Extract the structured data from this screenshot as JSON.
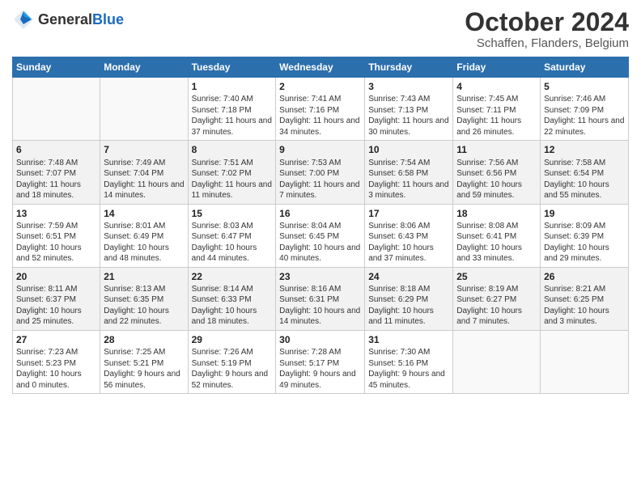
{
  "logo": {
    "general": "General",
    "blue": "Blue"
  },
  "title": "October 2024",
  "location": "Schaffen, Flanders, Belgium",
  "days_of_week": [
    "Sunday",
    "Monday",
    "Tuesday",
    "Wednesday",
    "Thursday",
    "Friday",
    "Saturday"
  ],
  "weeks": [
    [
      {
        "day": "",
        "sunrise": "",
        "sunset": "",
        "daylight": ""
      },
      {
        "day": "",
        "sunrise": "",
        "sunset": "",
        "daylight": ""
      },
      {
        "day": "1",
        "sunrise": "Sunrise: 7:40 AM",
        "sunset": "Sunset: 7:18 PM",
        "daylight": "Daylight: 11 hours and 37 minutes."
      },
      {
        "day": "2",
        "sunrise": "Sunrise: 7:41 AM",
        "sunset": "Sunset: 7:16 PM",
        "daylight": "Daylight: 11 hours and 34 minutes."
      },
      {
        "day": "3",
        "sunrise": "Sunrise: 7:43 AM",
        "sunset": "Sunset: 7:13 PM",
        "daylight": "Daylight: 11 hours and 30 minutes."
      },
      {
        "day": "4",
        "sunrise": "Sunrise: 7:45 AM",
        "sunset": "Sunset: 7:11 PM",
        "daylight": "Daylight: 11 hours and 26 minutes."
      },
      {
        "day": "5",
        "sunrise": "Sunrise: 7:46 AM",
        "sunset": "Sunset: 7:09 PM",
        "daylight": "Daylight: 11 hours and 22 minutes."
      }
    ],
    [
      {
        "day": "6",
        "sunrise": "Sunrise: 7:48 AM",
        "sunset": "Sunset: 7:07 PM",
        "daylight": "Daylight: 11 hours and 18 minutes."
      },
      {
        "day": "7",
        "sunrise": "Sunrise: 7:49 AM",
        "sunset": "Sunset: 7:04 PM",
        "daylight": "Daylight: 11 hours and 14 minutes."
      },
      {
        "day": "8",
        "sunrise": "Sunrise: 7:51 AM",
        "sunset": "Sunset: 7:02 PM",
        "daylight": "Daylight: 11 hours and 11 minutes."
      },
      {
        "day": "9",
        "sunrise": "Sunrise: 7:53 AM",
        "sunset": "Sunset: 7:00 PM",
        "daylight": "Daylight: 11 hours and 7 minutes."
      },
      {
        "day": "10",
        "sunrise": "Sunrise: 7:54 AM",
        "sunset": "Sunset: 6:58 PM",
        "daylight": "Daylight: 11 hours and 3 minutes."
      },
      {
        "day": "11",
        "sunrise": "Sunrise: 7:56 AM",
        "sunset": "Sunset: 6:56 PM",
        "daylight": "Daylight: 10 hours and 59 minutes."
      },
      {
        "day": "12",
        "sunrise": "Sunrise: 7:58 AM",
        "sunset": "Sunset: 6:54 PM",
        "daylight": "Daylight: 10 hours and 55 minutes."
      }
    ],
    [
      {
        "day": "13",
        "sunrise": "Sunrise: 7:59 AM",
        "sunset": "Sunset: 6:51 PM",
        "daylight": "Daylight: 10 hours and 52 minutes."
      },
      {
        "day": "14",
        "sunrise": "Sunrise: 8:01 AM",
        "sunset": "Sunset: 6:49 PM",
        "daylight": "Daylight: 10 hours and 48 minutes."
      },
      {
        "day": "15",
        "sunrise": "Sunrise: 8:03 AM",
        "sunset": "Sunset: 6:47 PM",
        "daylight": "Daylight: 10 hours and 44 minutes."
      },
      {
        "day": "16",
        "sunrise": "Sunrise: 8:04 AM",
        "sunset": "Sunset: 6:45 PM",
        "daylight": "Daylight: 10 hours and 40 minutes."
      },
      {
        "day": "17",
        "sunrise": "Sunrise: 8:06 AM",
        "sunset": "Sunset: 6:43 PM",
        "daylight": "Daylight: 10 hours and 37 minutes."
      },
      {
        "day": "18",
        "sunrise": "Sunrise: 8:08 AM",
        "sunset": "Sunset: 6:41 PM",
        "daylight": "Daylight: 10 hours and 33 minutes."
      },
      {
        "day": "19",
        "sunrise": "Sunrise: 8:09 AM",
        "sunset": "Sunset: 6:39 PM",
        "daylight": "Daylight: 10 hours and 29 minutes."
      }
    ],
    [
      {
        "day": "20",
        "sunrise": "Sunrise: 8:11 AM",
        "sunset": "Sunset: 6:37 PM",
        "daylight": "Daylight: 10 hours and 25 minutes."
      },
      {
        "day": "21",
        "sunrise": "Sunrise: 8:13 AM",
        "sunset": "Sunset: 6:35 PM",
        "daylight": "Daylight: 10 hours and 22 minutes."
      },
      {
        "day": "22",
        "sunrise": "Sunrise: 8:14 AM",
        "sunset": "Sunset: 6:33 PM",
        "daylight": "Daylight: 10 hours and 18 minutes."
      },
      {
        "day": "23",
        "sunrise": "Sunrise: 8:16 AM",
        "sunset": "Sunset: 6:31 PM",
        "daylight": "Daylight: 10 hours and 14 minutes."
      },
      {
        "day": "24",
        "sunrise": "Sunrise: 8:18 AM",
        "sunset": "Sunset: 6:29 PM",
        "daylight": "Daylight: 10 hours and 11 minutes."
      },
      {
        "day": "25",
        "sunrise": "Sunrise: 8:19 AM",
        "sunset": "Sunset: 6:27 PM",
        "daylight": "Daylight: 10 hours and 7 minutes."
      },
      {
        "day": "26",
        "sunrise": "Sunrise: 8:21 AM",
        "sunset": "Sunset: 6:25 PM",
        "daylight": "Daylight: 10 hours and 3 minutes."
      }
    ],
    [
      {
        "day": "27",
        "sunrise": "Sunrise: 7:23 AM",
        "sunset": "Sunset: 5:23 PM",
        "daylight": "Daylight: 10 hours and 0 minutes."
      },
      {
        "day": "28",
        "sunrise": "Sunrise: 7:25 AM",
        "sunset": "Sunset: 5:21 PM",
        "daylight": "Daylight: 9 hours and 56 minutes."
      },
      {
        "day": "29",
        "sunrise": "Sunrise: 7:26 AM",
        "sunset": "Sunset: 5:19 PM",
        "daylight": "Daylight: 9 hours and 52 minutes."
      },
      {
        "day": "30",
        "sunrise": "Sunrise: 7:28 AM",
        "sunset": "Sunset: 5:17 PM",
        "daylight": "Daylight: 9 hours and 49 minutes."
      },
      {
        "day": "31",
        "sunrise": "Sunrise: 7:30 AM",
        "sunset": "Sunset: 5:16 PM",
        "daylight": "Daylight: 9 hours and 45 minutes."
      },
      {
        "day": "",
        "sunrise": "",
        "sunset": "",
        "daylight": ""
      },
      {
        "day": "",
        "sunrise": "",
        "sunset": "",
        "daylight": ""
      }
    ]
  ],
  "shaded_rows": [
    1,
    3
  ],
  "empty_days_week1": [
    0,
    1
  ],
  "empty_days_week5": [
    5,
    6
  ]
}
